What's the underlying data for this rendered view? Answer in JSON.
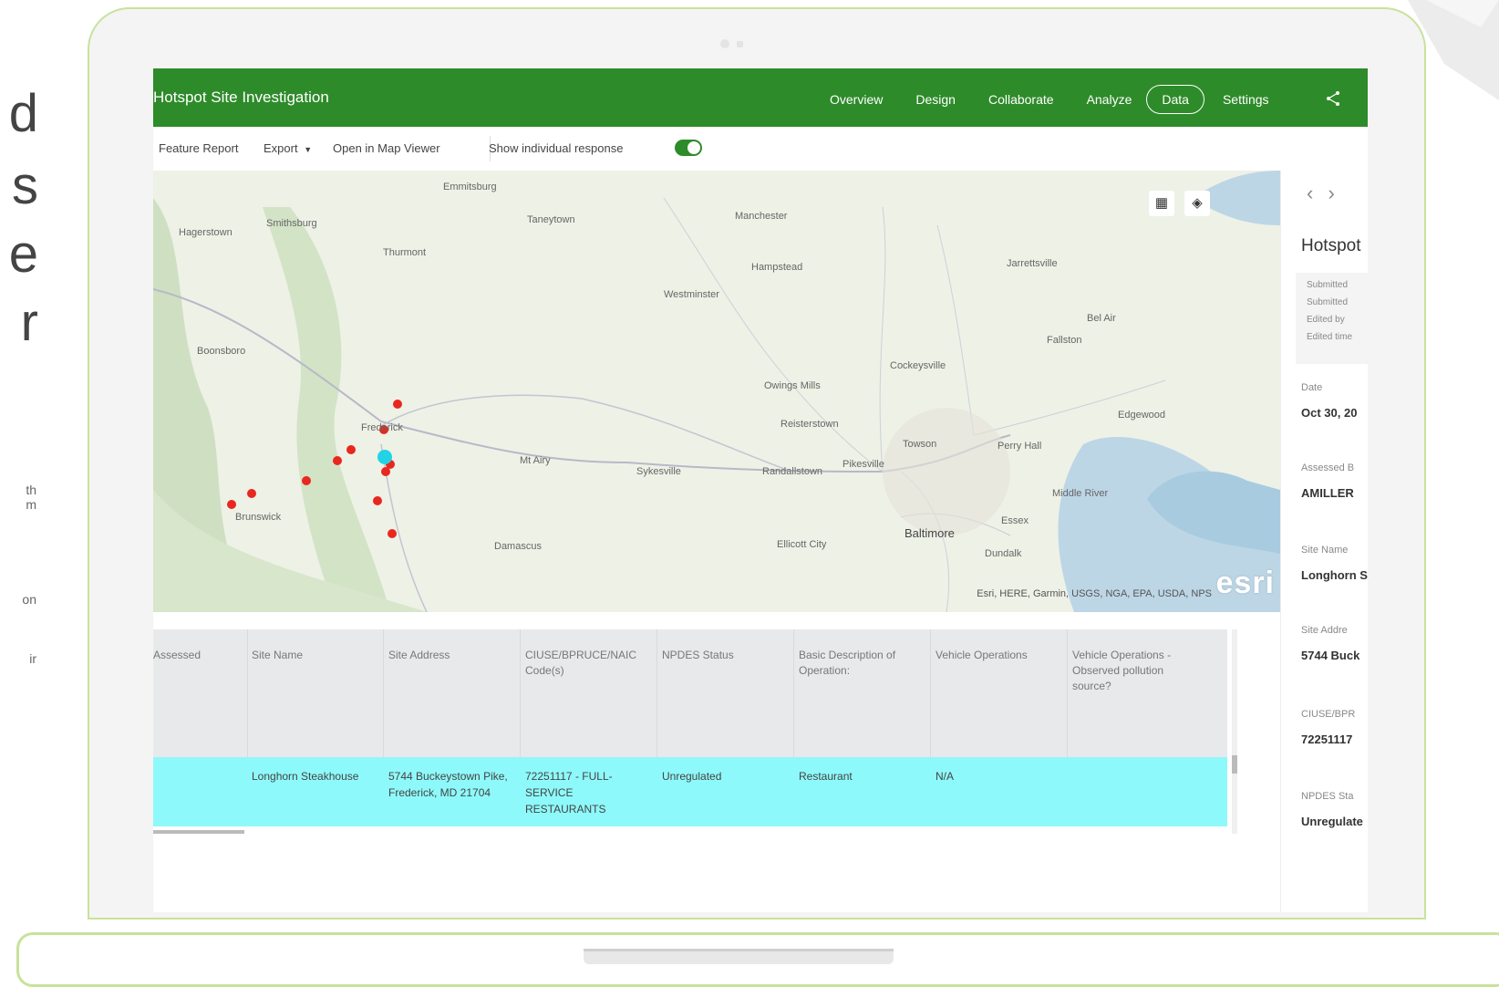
{
  "left_fragment": {
    "letters": [
      "d",
      "s",
      "e",
      "r"
    ],
    "small_lines": [
      "th",
      "m",
      "on",
      "ir"
    ]
  },
  "app": {
    "title": "Hotspot Site Investigation",
    "nav": [
      "Overview",
      "Design",
      "Collaborate",
      "Analyze",
      "Data",
      "Settings"
    ],
    "active_tab": "Data",
    "brand_color": "#2e8b2a"
  },
  "toolbar": {
    "feature_report": "Feature Report",
    "export": "Export",
    "open_map": "Open in Map Viewer",
    "show_individual": "Show individual response"
  },
  "map": {
    "attribution": "Esri, HERE, Garmin, USGS, NGA, EPA, USDA, NPS",
    "logo": "esri",
    "places": [
      "Emmitsburg",
      "Taneytown",
      "Manchester",
      "Hagerstown",
      "Smithsburg",
      "Thurmont",
      "Hampstead",
      "Westminster",
      "Boonsboro",
      "Frederick",
      "Mt Airy",
      "Sykesville",
      "Randallstown",
      "Pikesville",
      "Towson",
      "Perry Hall",
      "Baltimore",
      "Brunswick",
      "Damascus",
      "Ellicott City",
      "Essex",
      "Dundalk",
      "Middle River",
      "Reisterstown",
      "Owings Mills",
      "Jarrettsville",
      "Bel Air",
      "Fallston",
      "Edgewood",
      "Cockeysville"
    ]
  },
  "side_panel": {
    "title": "Hotspot",
    "meta": [
      "Submitted",
      "Submitted",
      "Edited by",
      "Edited time"
    ],
    "fields": [
      {
        "label": "Date",
        "value": "Oct 30, 20"
      },
      {
        "label": "Assessed B",
        "value": "AMILLER"
      },
      {
        "label": "Site Name",
        "value": "Longhorn S"
      },
      {
        "label": "Site Addre",
        "value": "5744 Buck"
      },
      {
        "label": "CIUSE/BPR",
        "value": "72251117"
      },
      {
        "label": "NPDES Sta",
        "value": "Unregulate"
      }
    ]
  },
  "table": {
    "headers": [
      "Assessed",
      "Site Name",
      "Site Address",
      "CIUSE/BPRUCE/NAIC Code(s)",
      "NPDES Status",
      "Basic Description of Operation:",
      "Vehicle Operations",
      "Vehicle Operations - Observed pollution source?"
    ],
    "row": [
      "",
      "Longhorn Steakhouse",
      "5744 Buckeystown Pike, Frederick, MD 21704",
      "72251117 - FULL-SERVICE RESTAURANTS",
      "Unregulated",
      "Restaurant",
      "N/A",
      ""
    ],
    "highlight_color": "#8ef9fa"
  }
}
